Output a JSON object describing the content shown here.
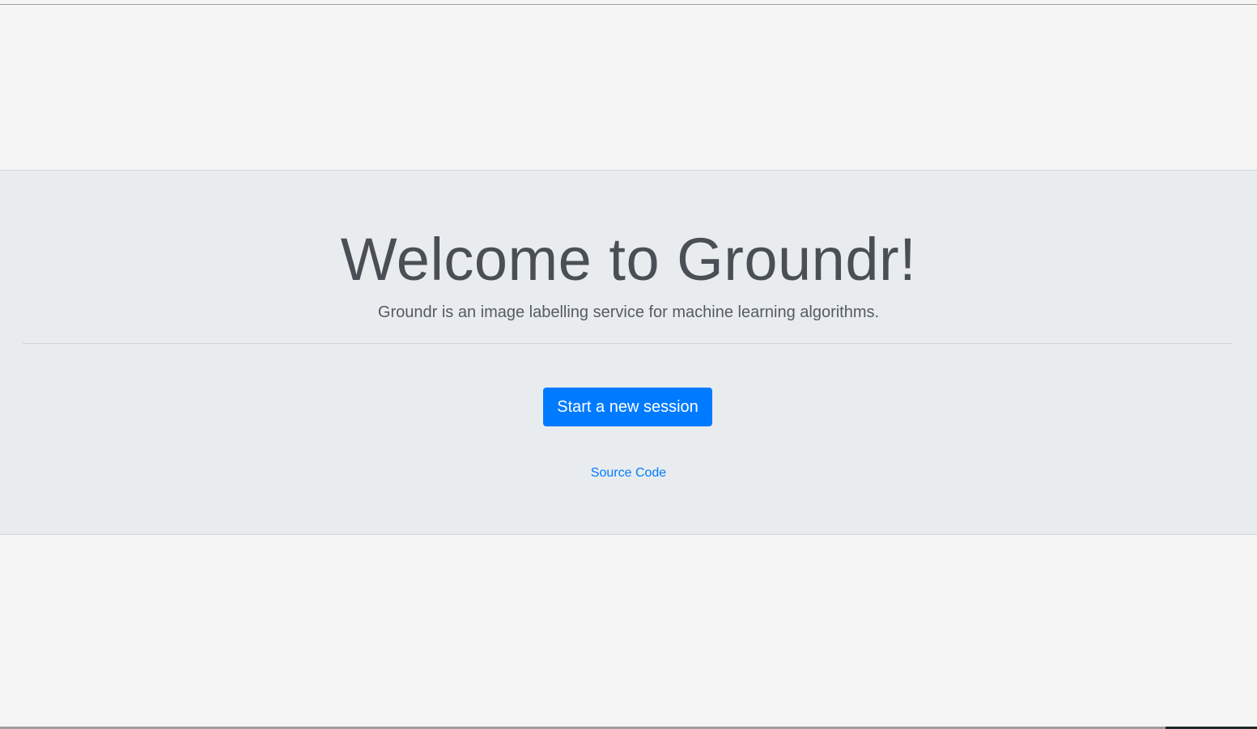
{
  "jumbotron": {
    "title": "Welcome to Groundr!",
    "lead": "Groundr is an image labelling service for machine learning algorithms.",
    "start_button_label": "Start a new session",
    "source_link_label": "Source Code"
  },
  "colors": {
    "primary": "#007bff",
    "jumbotron_bg": "#e9ecef",
    "page_bg": "#f5f5f5",
    "heading_text": "#4a4f56"
  }
}
